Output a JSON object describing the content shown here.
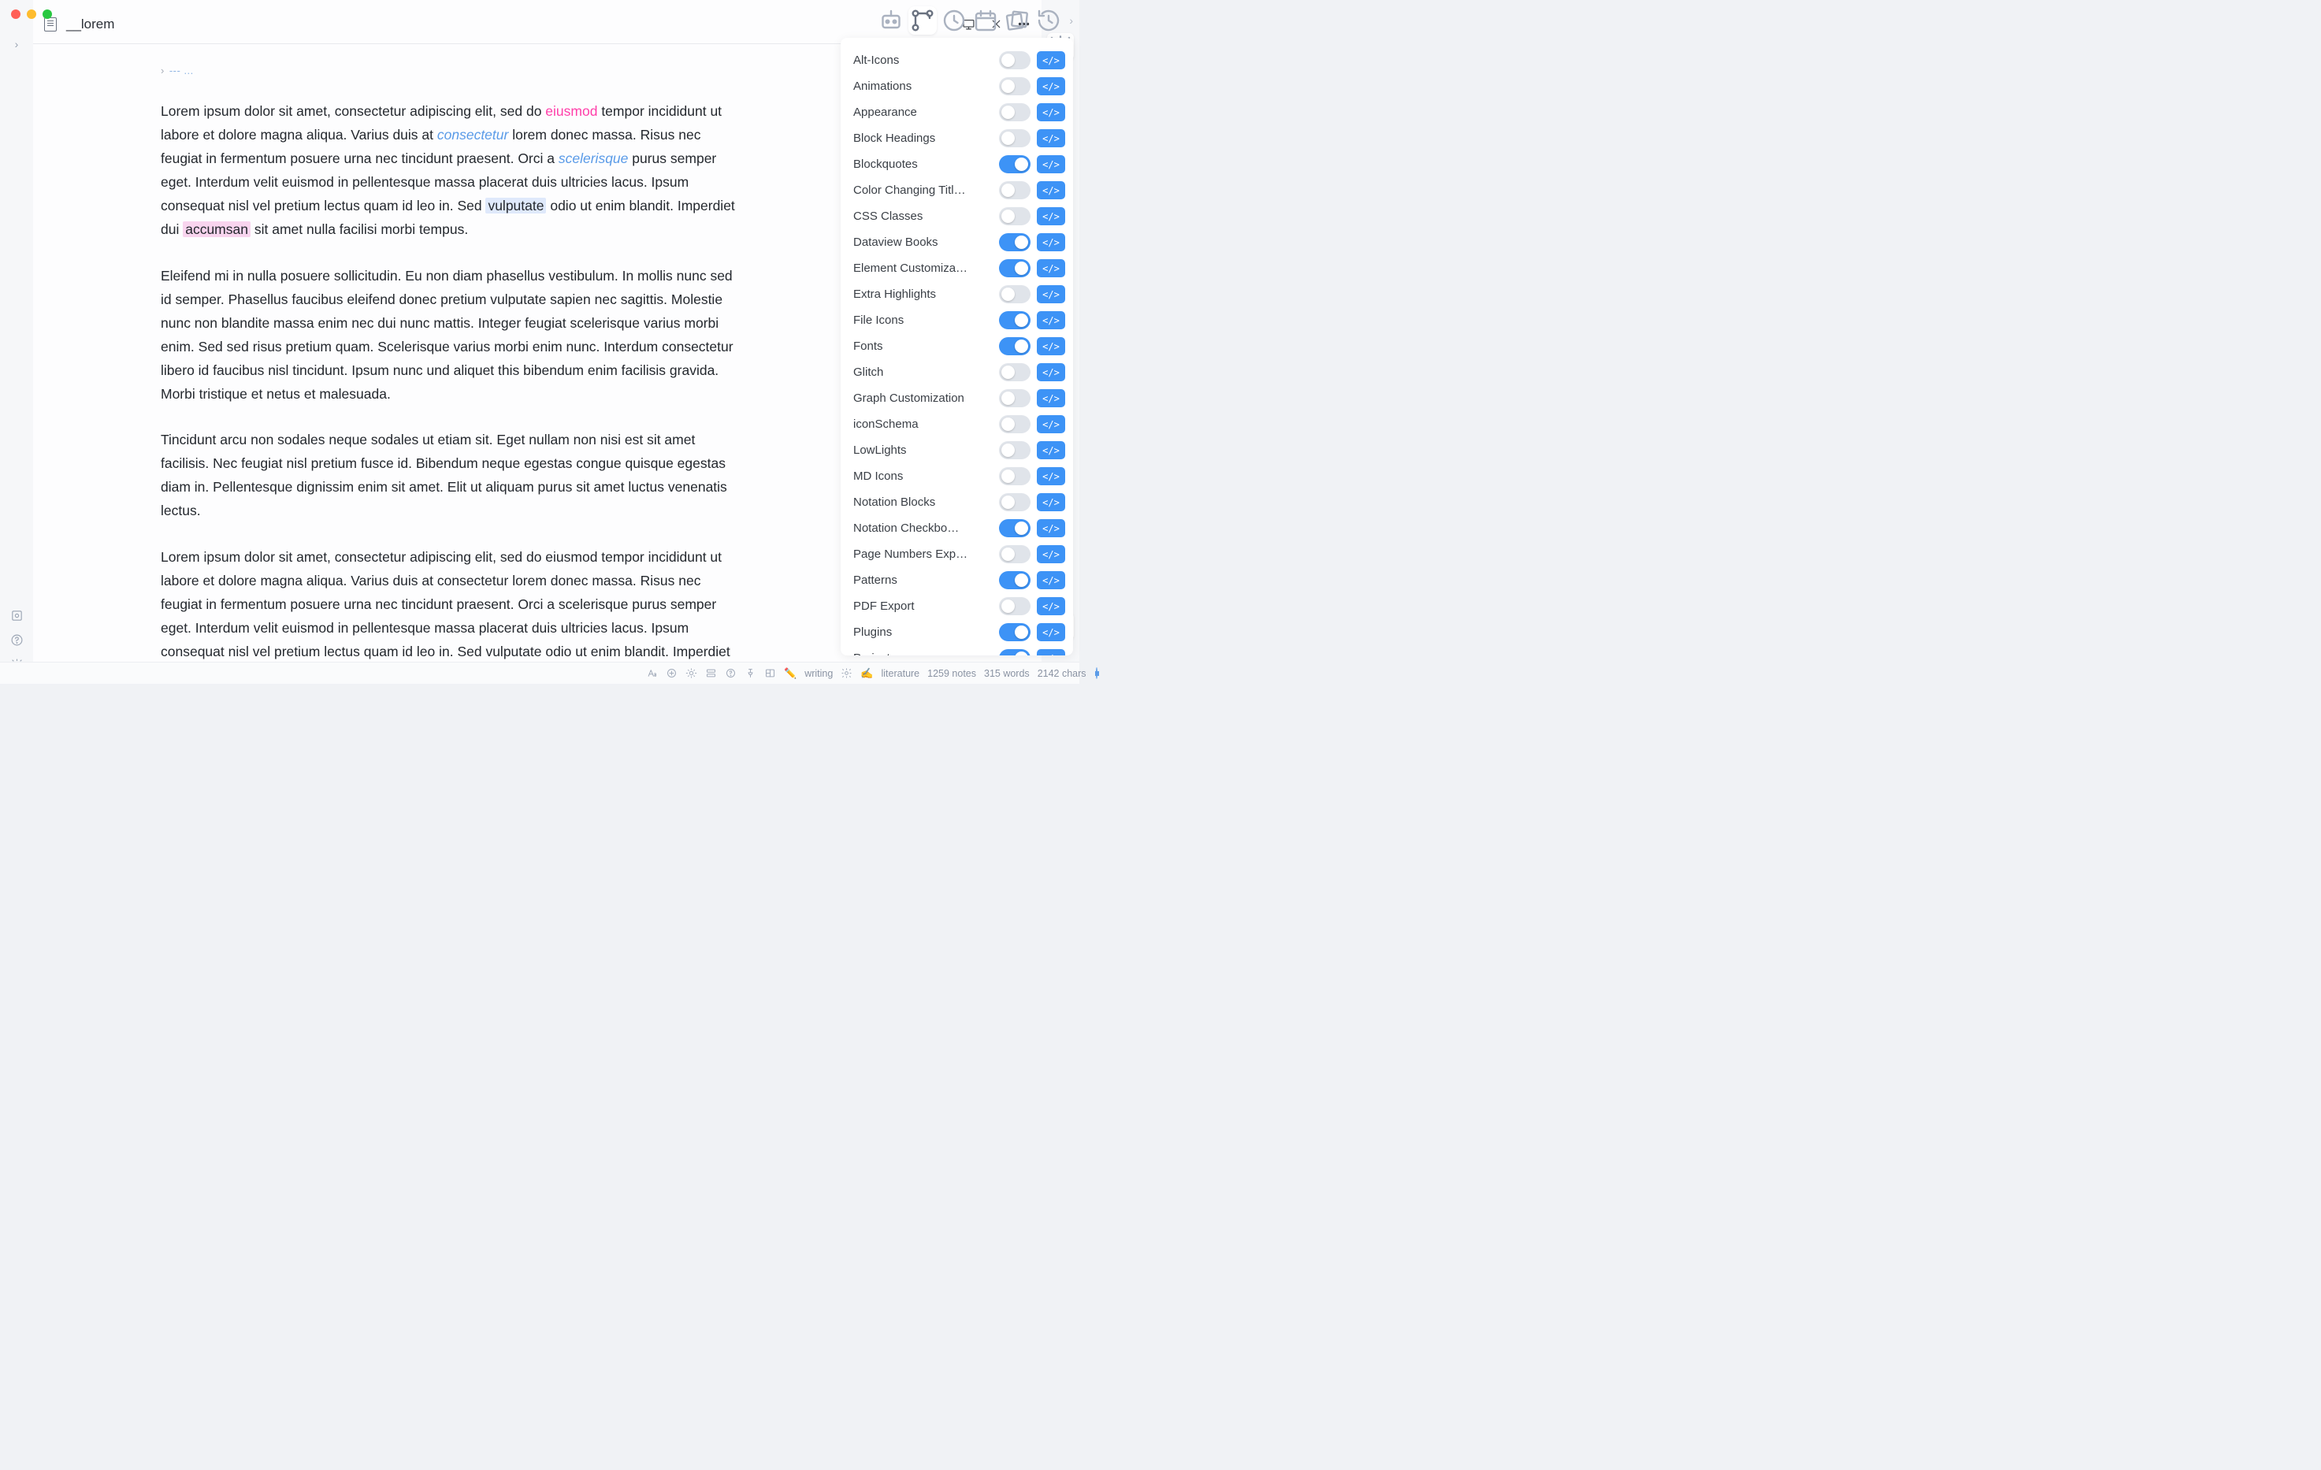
{
  "tab": {
    "title": "__lorem"
  },
  "crumbs": "--- ...",
  "paragraphs": {
    "p1a": "Lorem ipsum dolor sit amet, consectetur adipiscing elit, sed do ",
    "p1_pink": "eiusmod",
    "p1b": " tempor incididunt ut labore et dolore magna aliqua. Varius duis at ",
    "p1_blue": "consectetur",
    "p1c": " lorem donec massa. Risus nec feugiat in fermentum posuere urna nec tincidunt praesent. Orci a ",
    "p1_blue2": "scelerisque",
    "p1d": " purus semper eget. Interdum velit euismod in pellentesque massa placerat duis ultricies lacus. Ipsum consequat nisl vel pretium lectus quam id leo in. Sed ",
    "p1_hlblue": "vulputate",
    "p1e": " odio ut enim blandit. Imperdiet dui ",
    "p1_hlpink": "accumsan",
    "p1f": " sit amet nulla facilisi morbi tempus.",
    "p2": "Eleifend mi in nulla posuere sollicitudin. Eu non diam phasellus vestibulum. In mollis nunc sed id semper. Phasellus faucibus eleifend donec pretium vulputate sapien nec sagittis. Molestie nunc non blandite massa enim nec dui nunc mattis. Integer feugiat scelerisque varius morbi enim. Sed sed risus pretium quam. Scelerisque varius morbi enim nunc. Interdum consectetur libero id faucibus nisl tincidunt. Ipsum nunc und aliquet this bibendum enim facilisis gravida. Morbi tristique et netus et malesuada.",
    "p3": "Tincidunt arcu non sodales neque sodales ut etiam sit. Eget nullam non nisi est sit amet facilisis. Nec feugiat nisl pretium fusce id. Bibendum neque egestas congue quisque egestas diam in. Pellentesque dignissim enim sit amet. Elit ut aliquam purus sit amet luctus venenatis lectus.",
    "p4": "Lorem ipsum dolor sit amet, consectetur adipiscing elit, sed do eiusmod tempor incididunt ut labore et dolore magna aliqua. Varius duis at consectetur lorem donec massa. Risus nec feugiat in fermentum posuere urna nec tincidunt praesent. Orci a scelerisque purus semper eget. Interdum velit euismod in pellentesque massa placerat duis ultricies lacus. Ipsum consequat nisl vel pretium lectus quam id leo in. Sed vulputate odio ut enim blandit. Imperdiet dui accumsan sit amet nulla facilisi morbi tempus. Eleifend mi in"
  },
  "snippets": [
    {
      "label": "Alt-Icons",
      "on": false
    },
    {
      "label": "Animations",
      "on": false
    },
    {
      "label": "Appearance",
      "on": false
    },
    {
      "label": "Block Headings",
      "on": false
    },
    {
      "label": "Blockquotes",
      "on": true
    },
    {
      "label": "Color Changing Titl…",
      "on": false
    },
    {
      "label": "CSS Classes",
      "on": false
    },
    {
      "label": "Dataview Books",
      "on": true
    },
    {
      "label": "Element Customiza…",
      "on": true
    },
    {
      "label": "Extra Highlights",
      "on": false
    },
    {
      "label": "File Icons",
      "on": true
    },
    {
      "label": "Fonts",
      "on": true
    },
    {
      "label": "Glitch",
      "on": false
    },
    {
      "label": "Graph Customization",
      "on": false
    },
    {
      "label": "iconSchema",
      "on": false
    },
    {
      "label": "LowLights",
      "on": false
    },
    {
      "label": "MD Icons",
      "on": false
    },
    {
      "label": "Notation Blocks",
      "on": false
    },
    {
      "label": "Notation Checkbo…",
      "on": true
    },
    {
      "label": "Page Numbers Exp…",
      "on": false
    },
    {
      "label": "Patterns",
      "on": true
    },
    {
      "label": "PDF Export",
      "on": false
    },
    {
      "label": "Plugins",
      "on": true
    },
    {
      "label": "Projects",
      "on": true
    }
  ],
  "code_glyph": "</>",
  "status": {
    "writing": "writing",
    "literature": "literature",
    "notes": "1259 notes",
    "words": "315 words",
    "chars": "2142 chars"
  }
}
